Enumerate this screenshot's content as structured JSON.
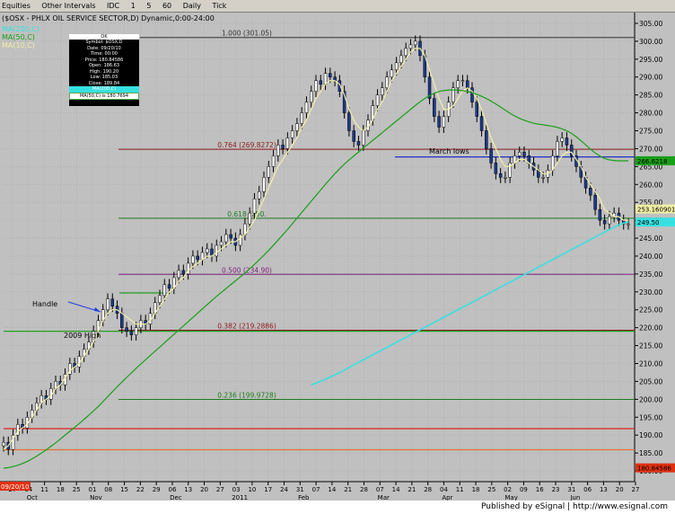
{
  "toolbar": {
    "items": [
      "Equities",
      "Other Intervals",
      "IDC",
      "1",
      "5",
      "60",
      "Daily",
      "Tick"
    ]
  },
  "header": {
    "title": "($OSX - PHLX OIL SERVICE SECTOR,D) Dynamic,0:00-24:00",
    "ma200": "MA(200,C)",
    "ma50": "MA(50,C)",
    "ma10": "MA(10,C)"
  },
  "infobox": {
    "head": "OK",
    "rows": [
      "Symbol: $OSX,D",
      "Date: 09/20/10",
      "Time: 00:00",
      "Price: 180.84586",
      "Open: 186.63",
      "High: 190.20",
      "Low: 185.03",
      "Close: 189.84"
    ],
    "ma200_label": "MA(200,C)",
    "ma50_label": "MA(50,C) is 180.7694"
  },
  "footer": {
    "date": "09/20/10",
    "publisher": "Published by eSignal | http://www.esignal.com"
  },
  "chart_data": {
    "type": "line",
    "title": "($OSX - PHLX OIL SERVICE SECTOR,D) Dynamic,0:00-24:00",
    "ylim": [
      178,
      307
    ],
    "yticks": [
      180,
      185,
      190,
      195,
      200,
      205,
      210,
      215,
      220,
      225,
      230,
      235,
      240,
      245,
      250,
      255,
      260,
      265,
      270,
      275,
      280,
      285,
      290,
      295,
      300,
      305
    ],
    "x_labels": [
      "27",
      "04",
      "11",
      "18",
      "25",
      "01",
      "08",
      "15",
      "22",
      "29",
      "06",
      "13",
      "20",
      "27",
      "03",
      "10",
      "17",
      "24",
      "31",
      "07",
      "14",
      "21",
      "28",
      "07",
      "14",
      "21",
      "28",
      "04",
      "11",
      "18",
      "25",
      "02",
      "09",
      "16",
      "23",
      "31",
      "06",
      "13",
      "20",
      "27"
    ],
    "month_labels": [
      "Oct",
      "Nov",
      "Dec",
      "2011",
      "Feb",
      "Mar",
      "Apr",
      "May",
      "Jun"
    ],
    "fib_levels": [
      {
        "label": "1.000 (301.05)",
        "value": 301.05,
        "color": "#333333"
      },
      {
        "label": "0.764 (269.8272)",
        "value": 269.8272,
        "color": "#8b1a1a"
      },
      {
        "label": "0.618 (250.",
        "value": 250.55,
        "color": "#1e7a1e"
      },
      {
        "label": "0.500 (234.90)",
        "value": 234.9,
        "color": "#7a1e7a"
      },
      {
        "label": "0.382 (219.2886)",
        "value": 219.2886,
        "color": "#8b1a1a"
      },
      {
        "label": "0.236 (199.9728)",
        "value": 199.9728,
        "color": "#1e7a1e"
      }
    ],
    "annotations": [
      "Handle",
      "2009 High",
      "March lows"
    ],
    "price_tags": [
      {
        "value": 266.6218,
        "label": "266.6218",
        "color": "#18a018"
      },
      {
        "value": 253.16,
        "label": "253.160901",
        "color": "#f2efa6"
      },
      {
        "value": 249.5,
        "label": "249.50",
        "color": "#37e0e0"
      },
      {
        "value": 180.84586,
        "label": "180.84586",
        "color": "#e03010"
      }
    ],
    "horizontal_lines": [
      {
        "value": 191.8,
        "color": "#e02020"
      },
      {
        "value": 185.9,
        "color": "#e07030"
      },
      {
        "value": 219.0,
        "color": "#20a020"
      },
      {
        "value": 267.7,
        "color": "#2030c0"
      },
      {
        "value": 229.7,
        "color": "#20a020"
      }
    ],
    "series": [
      {
        "name": "Price",
        "values": [
          188,
          186,
          190,
          193,
          192,
          195,
          197,
          199,
          201,
          200,
          203,
          205,
          204,
          207,
          210,
          209,
          212,
          214,
          216,
          219,
          222,
          225,
          228,
          226,
          224,
          220,
          219,
          218,
          220,
          222,
          221,
          224,
          227,
          229,
          232,
          231,
          234,
          236,
          235,
          238,
          240,
          239,
          241,
          242,
          240,
          243,
          244,
          246,
          245,
          243,
          246,
          249,
          252,
          256,
          258,
          262,
          265,
          268,
          271,
          270,
          273,
          275,
          277,
          280,
          283,
          286,
          289,
          288,
          291,
          290,
          289,
          286,
          280,
          275,
          272,
          271,
          275,
          278,
          282,
          285,
          287,
          290,
          292,
          294,
          296,
          298,
          299,
          300,
          296,
          290,
          284,
          279,
          276,
          279,
          283,
          287,
          289,
          289,
          287,
          283,
          279,
          275,
          270,
          266,
          263,
          262,
          262,
          266,
          268,
          269,
          268,
          266,
          264,
          262,
          262,
          264,
          268,
          272,
          273,
          271,
          268,
          265,
          262,
          259,
          257,
          253,
          250,
          249,
          251,
          252,
          250,
          249,
          249
        ]
      },
      {
        "name": "MA(10,C)",
        "values": [
          186,
          187,
          189,
          191,
          192,
          193,
          195,
          197,
          199,
          200,
          201,
          203,
          204,
          206,
          208,
          209,
          210,
          212,
          214,
          216,
          219,
          222,
          224,
          225,
          225,
          224,
          223,
          222,
          221,
          221,
          221,
          222,
          224,
          226,
          228,
          230,
          231,
          233,
          234,
          236,
          237,
          238,
          239,
          240,
          240,
          241,
          242,
          243,
          244,
          244,
          245,
          246,
          248,
          250,
          253,
          256,
          259,
          262,
          265,
          267,
          269,
          271,
          273,
          276,
          278,
          281,
          284,
          286,
          288,
          289,
          289,
          288,
          285,
          281,
          278,
          276,
          275,
          276,
          278,
          281,
          283,
          286,
          289,
          291,
          293,
          295,
          297,
          298,
          298,
          296,
          292,
          288,
          284,
          281,
          281,
          282,
          284,
          286,
          287,
          286,
          284,
          281,
          277,
          273,
          270,
          267,
          265,
          265,
          266,
          267,
          267,
          266,
          265,
          264,
          263,
          263,
          264,
          266,
          268,
          269,
          269,
          267,
          265,
          262,
          260,
          258,
          256,
          253,
          252,
          251,
          251,
          250,
          250
        ]
      },
      {
        "name": "MA(50,C)",
        "values": [
          180.7694,
          180.9,
          181.2,
          181.6,
          182.1,
          182.7,
          183.4,
          184.2,
          185.1,
          186.0,
          187.0,
          188.0,
          189.1,
          190.2,
          191.3,
          192.4,
          193.5,
          194.7,
          195.9,
          197.1,
          198.4,
          199.8,
          201.2,
          202.6,
          204.0,
          205.3,
          206.6,
          207.9,
          209.2,
          210.4,
          211.6,
          212.8,
          214.0,
          215.2,
          216.4,
          217.6,
          218.8,
          220.0,
          221.2,
          222.4,
          223.6,
          224.8,
          226.0,
          227.2,
          228.4,
          229.5,
          230.6,
          231.7,
          232.8,
          233.9,
          235.0,
          236.2,
          237.4,
          238.7,
          240.0,
          241.4,
          242.8,
          244.3,
          245.8,
          247.3,
          248.9,
          250.5,
          252.1,
          253.7,
          255.3,
          256.9,
          258.5,
          260.1,
          261.6,
          263.1,
          264.5,
          265.8,
          267.0,
          268.1,
          269.2,
          270.3,
          271.4,
          272.5,
          273.6,
          274.7,
          275.8,
          276.9,
          278.0,
          279.1,
          280.2,
          281.3,
          282.4,
          283.4,
          284.3,
          285.1,
          285.7,
          286.1,
          286.3,
          286.4,
          286.4,
          286.3,
          286.1,
          285.8,
          285.4,
          284.9,
          284.3,
          283.6,
          282.8,
          282.0,
          281.1,
          280.2,
          279.4,
          278.7,
          278.1,
          277.6,
          277.2,
          276.9,
          276.7,
          276.5,
          276.3,
          276.0,
          275.6,
          275.1,
          274.4,
          273.5,
          272.4,
          271.2,
          270.0,
          268.9,
          268.0,
          267.3,
          266.9,
          266.7,
          266.6,
          266.6,
          266.6218
        ]
      },
      {
        "name": "MA(200,C)",
        "values": [
          null,
          null,
          null,
          null,
          null,
          null,
          null,
          null,
          null,
          null,
          null,
          null,
          null,
          null,
          null,
          null,
          null,
          null,
          null,
          null,
          null,
          null,
          null,
          null,
          null,
          null,
          null,
          null,
          null,
          null,
          null,
          null,
          null,
          null,
          null,
          null,
          null,
          null,
          null,
          null,
          null,
          null,
          null,
          null,
          null,
          null,
          null,
          null,
          null,
          null,
          null,
          null,
          null,
          null,
          null,
          null,
          null,
          null,
          null,
          null,
          null,
          null,
          null,
          null,
          null,
          204,
          204.5,
          205.0,
          205.6,
          206.2,
          206.8,
          207.5,
          208.2,
          208.9,
          209.6,
          210.3,
          211.0,
          211.7,
          212.4,
          213.1,
          213.8,
          214.5,
          215.2,
          215.9,
          216.6,
          217.3,
          218.0,
          218.7,
          219.4,
          220.1,
          220.8,
          221.5,
          222.2,
          222.9,
          223.6,
          224.3,
          225.0,
          225.7,
          226.4,
          227.1,
          227.8,
          228.5,
          229.2,
          229.9,
          230.6,
          231.3,
          232.0,
          232.7,
          233.4,
          234.1,
          234.8,
          235.5,
          236.2,
          236.9,
          237.6,
          238.3,
          239.0,
          239.7,
          240.4,
          241.1,
          241.8,
          242.5,
          243.2,
          243.9,
          244.6,
          245.3,
          246.0,
          246.7,
          247.4,
          248.1,
          248.7,
          249.2,
          249.5
        ]
      }
    ]
  }
}
